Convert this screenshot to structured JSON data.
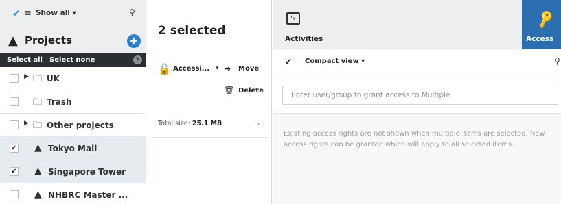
{
  "sidebar": {
    "top": {
      "show_all_label": "Show all ▾"
    },
    "header": {
      "title": "Projects",
      "add_symbol": "+"
    },
    "selection_bar": {
      "select_all": "Select all",
      "select_none": "Select none",
      "clear_symbol": "✕"
    },
    "tree": [
      {
        "label": "UK",
        "icon": "folder-icon",
        "has_children": true,
        "checked": false,
        "selected": false
      },
      {
        "label": "Trash",
        "icon": "folder-icon",
        "has_children": false,
        "checked": false,
        "selected": false
      },
      {
        "label": "Other projects",
        "icon": "folder-icon",
        "has_children": true,
        "checked": false,
        "selected": false
      },
      {
        "label": "Tokyo Mall",
        "icon": "project-icon",
        "has_children": false,
        "checked": true,
        "selected": true
      },
      {
        "label": "Singapore Tower",
        "icon": "project-icon",
        "has_children": false,
        "checked": true,
        "selected": true
      },
      {
        "label": "NHBRC Master ...",
        "icon": "project-icon",
        "has_children": false,
        "checked": false,
        "selected": false
      }
    ]
  },
  "middle": {
    "heading": "2 selected",
    "actions": {
      "access": "Accessi...",
      "move": "Move",
      "delete": "Delete"
    },
    "total_size_label": "Total size:",
    "total_size_value": "25.1 MB"
  },
  "right": {
    "tabs": {
      "activities": "Activities",
      "access": "Access"
    },
    "toolbar": {
      "compact_view": "Compact view ▾"
    },
    "grant_input": {
      "placeholder": "Enter user/group to grant access to Multiple",
      "value": ""
    },
    "info_text": "Existing access rights are not shown when multiple items are selected. New access rights can be granted which will apply to all selected items."
  },
  "colors": {
    "accent": "#2b6fb0",
    "add_button": "#2a7fd1",
    "selection_bar": "#2b2f33",
    "selected_row": "#e6ebf0"
  }
}
